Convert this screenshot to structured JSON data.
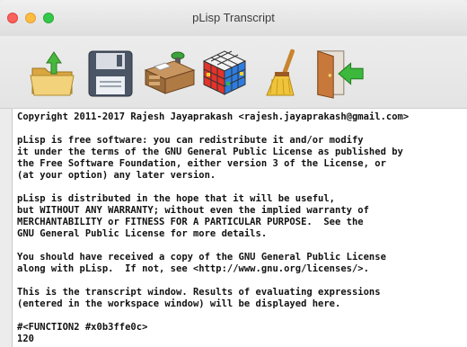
{
  "window": {
    "title": "pLisp Transcript"
  },
  "toolbar": {
    "buttons": [
      {
        "name": "open-file",
        "icon": "folder-up-arrow-icon"
      },
      {
        "name": "save",
        "icon": "floppy-disk-icon"
      },
      {
        "name": "workspace",
        "icon": "desk-icon"
      },
      {
        "name": "object-browser",
        "icon": "rubiks-cube-icon"
      },
      {
        "name": "clean",
        "icon": "broom-icon"
      },
      {
        "name": "exit",
        "icon": "exit-door-icon"
      }
    ]
  },
  "transcript": {
    "text": "Copyright 2011-2017 Rajesh Jayaprakash <rajesh.jayaprakash@gmail.com>\n\npLisp is free software: you can redistribute it and/or modify\nit under the terms of the GNU General Public License as published by\nthe Free Software Foundation, either version 3 of the License, or\n(at your option) any later version.\n\npLisp is distributed in the hope that it will be useful,\nbut WITHOUT ANY WARRANTY; without even the implied warranty of\nMERCHANTABILITY or FITNESS FOR A PARTICULAR PURPOSE.  See the\nGNU General Public License for more details.\n\nYou should have received a copy of the GNU General Public License\nalong with pLisp.  If not, see <http://www.gnu.org/licenses/>.\n\nThis is the transcript window. Results of evaluating expressions\n(entered in the workspace window) will be displayed here.\n\n#<FUNCTION2 #x0b3ffe0c>\n120"
  },
  "colors": {
    "close": "#fc605c",
    "minimize": "#fdbc40",
    "maximize": "#34c84a"
  }
}
